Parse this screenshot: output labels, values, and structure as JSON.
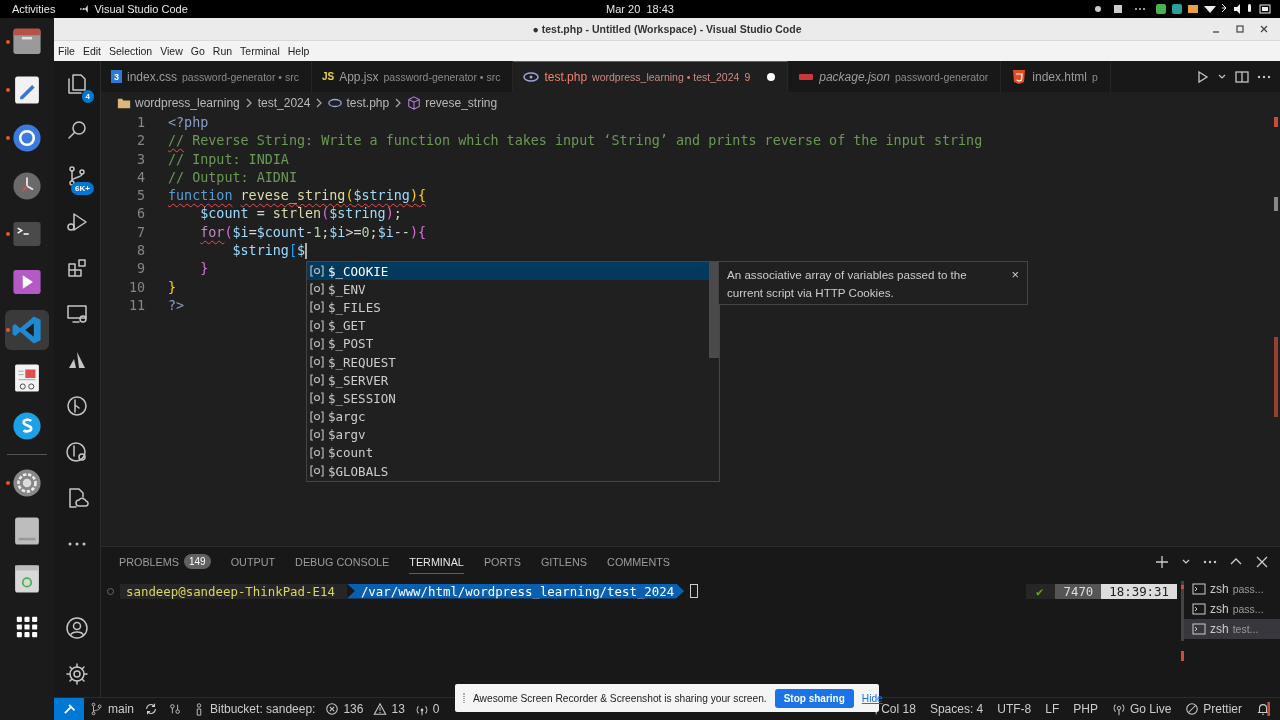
{
  "system_bar": {
    "activities": "Activities",
    "app": "Visual Studio Code",
    "clock": "Mar 20  18:43"
  },
  "dock": [
    {
      "kind": "folder",
      "running": true,
      "selected": false
    },
    {
      "kind": "text-editor",
      "running": true,
      "selected": false
    },
    {
      "kind": "browser",
      "running": true,
      "selected": false
    },
    {
      "kind": "clock",
      "running": false,
      "selected": false
    },
    {
      "kind": "terminal",
      "running": true,
      "selected": false
    },
    {
      "kind": "media-player",
      "running": false,
      "selected": false
    },
    {
      "kind": "code-editor",
      "running": true,
      "selected": true
    },
    {
      "kind": "document-viewer",
      "running": false,
      "selected": false
    },
    {
      "kind": "chat-app",
      "running": false,
      "selected": false
    },
    {
      "kind": "settings",
      "running": true,
      "selected": false
    },
    {
      "kind": "drive",
      "running": false,
      "selected": false
    },
    {
      "kind": "trash",
      "running": false,
      "selected": false
    },
    {
      "kind": "app-grid",
      "running": false,
      "selected": false
    }
  ],
  "window": {
    "title": "● test.php - Untitled (Workspace) - Visual Studio Code"
  },
  "menu": [
    "File",
    "Edit",
    "Selection",
    "View",
    "Go",
    "Run",
    "Terminal",
    "Help"
  ],
  "activity_bar": [
    {
      "kind": "explorer",
      "badge": "4"
    },
    {
      "kind": "search"
    },
    {
      "kind": "source-control",
      "badge": "6K+"
    },
    {
      "kind": "run-debug"
    },
    {
      "kind": "extensions"
    },
    {
      "kind": "remote"
    },
    {
      "kind": "atlassian"
    },
    {
      "kind": "gitlens"
    },
    {
      "kind": "gitlens-inspect"
    },
    {
      "kind": "cloud-doc"
    },
    {
      "kind": "more"
    }
  ],
  "activity_bar_bottom": [
    {
      "kind": "account"
    },
    {
      "kind": "manage"
    }
  ],
  "tabs": [
    {
      "kind": "css",
      "icon_text": "3",
      "name": "index.css",
      "path": "password-generator • src",
      "selected": false,
      "modified": false,
      "italic": false
    },
    {
      "kind": "js",
      "icon_text": "JS",
      "name": "App.jsx",
      "path": "password-generator • src",
      "selected": false,
      "modified": false,
      "italic": false
    },
    {
      "kind": "php",
      "name": "test.php",
      "path": "wordpress_learning • test_2024",
      "problems": "9",
      "selected": true,
      "modified": true,
      "italic": false
    },
    {
      "kind": "json",
      "name": "package.json",
      "path": "password-generator",
      "selected": false,
      "modified": false,
      "italic": true
    },
    {
      "kind": "html",
      "name": "index.html",
      "path": "p",
      "selected": false,
      "modified": false,
      "italic": false
    }
  ],
  "breadcrumb": [
    "wordpress_learning",
    "test_2024",
    "test.php",
    "revese_string"
  ],
  "editor": {
    "lines": [
      {
        "num": "1",
        "tokens": [
          {
            "kind": "tag",
            "t": "<?php"
          }
        ]
      },
      {
        "num": "2",
        "tokens": [
          {
            "kind": "comment",
            "t": "//",
            "err": true
          },
          {
            "kind": "comment",
            "t": " Reverse String: Write a function which takes input ‘String’ and prints reverse of the input string"
          }
        ]
      },
      {
        "num": "3",
        "tokens": [
          {
            "kind": "comment",
            "t": "// Input: INDIA"
          }
        ]
      },
      {
        "num": "4",
        "tokens": [
          {
            "kind": "comment",
            "t": "// Output: AIDNI"
          }
        ]
      },
      {
        "num": "5",
        "tokens": [
          {
            "kind": "kw",
            "t": "function",
            "err": true
          },
          {
            "kind": "fn",
            "t": " revese_string",
            "err": true
          },
          {
            "kind": "b1",
            "t": "(",
            "err": true
          },
          {
            "kind": "var",
            "t": "$string",
            "err": true
          },
          {
            "kind": "b1",
            "t": ")",
            "err": true
          },
          {
            "kind": "b1",
            "t": "{",
            "err": true
          }
        ]
      },
      {
        "num": "6",
        "tokens": [
          {
            "kind": "var",
            "t": "    $count"
          },
          {
            "kind": "plain",
            "t": " = "
          },
          {
            "kind": "fn",
            "t": "strlen"
          },
          {
            "kind": "b2",
            "t": "("
          },
          {
            "kind": "var",
            "t": "$string"
          },
          {
            "kind": "b2",
            "t": ")"
          },
          {
            "kind": "plain",
            "t": ";"
          }
        ]
      },
      {
        "num": "7",
        "tokens": [
          {
            "kind": "ctrl",
            "t": "    for",
            "err": true
          },
          {
            "kind": "b2",
            "t": "("
          },
          {
            "kind": "var",
            "t": "$i"
          },
          {
            "kind": "plain",
            "t": "="
          },
          {
            "kind": "var",
            "t": "$count"
          },
          {
            "kind": "plain",
            "t": "-"
          },
          {
            "kind": "num",
            "t": "1"
          },
          {
            "kind": "plain",
            "t": ";"
          },
          {
            "kind": "var",
            "t": "$i"
          },
          {
            "kind": "plain",
            "t": ">="
          },
          {
            "kind": "num",
            "t": "0"
          },
          {
            "kind": "plain",
            "t": ";"
          },
          {
            "kind": "var",
            "t": "$i"
          },
          {
            "kind": "plain",
            "t": "--"
          },
          {
            "kind": "b2",
            "t": ")"
          },
          {
            "kind": "b2",
            "t": "{"
          }
        ]
      },
      {
        "num": "8",
        "cursor": true,
        "tokens": [
          {
            "kind": "var",
            "t": "        $string"
          },
          {
            "kind": "b3",
            "t": "["
          },
          {
            "kind": "var",
            "t": "$"
          }
        ]
      },
      {
        "num": "9",
        "tokens": [
          {
            "kind": "b2",
            "t": "    }"
          }
        ]
      },
      {
        "num": "10",
        "tokens": [
          {
            "kind": "b1",
            "t": "}"
          }
        ]
      },
      {
        "num": "11",
        "tokens": [
          {
            "kind": "tag",
            "t": "?>"
          }
        ]
      }
    ]
  },
  "suggestions": {
    "items": [
      {
        "label": "$_COOKIE",
        "selected": true
      },
      {
        "label": "$_ENV",
        "selected": false
      },
      {
        "label": "$_FILES",
        "selected": false
      },
      {
        "label": "$_GET",
        "selected": false
      },
      {
        "label": "$_POST",
        "selected": false
      },
      {
        "label": "$_REQUEST",
        "selected": false
      },
      {
        "label": "$_SERVER",
        "selected": false
      },
      {
        "label": "$_SESSION",
        "selected": false
      },
      {
        "label": "$argc",
        "selected": false
      },
      {
        "label": "$argv",
        "selected": false
      },
      {
        "label": "$count",
        "selected": false
      },
      {
        "label": "$GLOBALS",
        "selected": false
      }
    ],
    "details": "An associative array of variables passed to the current script via HTTP Cookies.",
    "close": "×"
  },
  "panel": {
    "tabs": [
      {
        "label": "PROBLEMS",
        "badge": "149",
        "selected": false
      },
      {
        "label": "OUTPUT",
        "selected": false
      },
      {
        "label": "DEBUG CONSOLE",
        "selected": false
      },
      {
        "label": "TERMINAL",
        "selected": true
      },
      {
        "label": "PORTS",
        "selected": false
      },
      {
        "label": "GITLENS",
        "selected": false
      },
      {
        "label": "COMMENTS",
        "selected": false
      }
    ],
    "terminal": {
      "user": "sandeep@sandeep-ThinkPad-E14",
      "path": "/var/www/html/wordpress_learning/test_2024",
      "status": "✔",
      "pid": "7470",
      "time": "18:39:31"
    },
    "terminals": [
      {
        "label": "zsh",
        "detail": "pass...",
        "selected": false
      },
      {
        "label": "zsh",
        "detail": "pass...",
        "selected": false
      },
      {
        "label": "zsh",
        "detail": "test...",
        "selected": true
      }
    ]
  },
  "status_bar": {
    "left": [
      {
        "kind": "branch",
        "text": "main"
      },
      {
        "kind": "sync"
      },
      {
        "kind": "liveshare"
      },
      {
        "kind": "person",
        "text": "Bitbucket: sandeep:"
      },
      {
        "kind": "errors",
        "text": "136"
      },
      {
        "kind": "warnings",
        "text": "13"
      },
      {
        "kind": "ports",
        "text": "0"
      }
    ],
    "right": [
      {
        "kind": "plain",
        "text": ", Col 18"
      },
      {
        "kind": "plain",
        "text": "Spaces: 4"
      },
      {
        "kind": "plain",
        "text": "UTF-8"
      },
      {
        "kind": "plain",
        "text": "LF"
      },
      {
        "kind": "plain",
        "text": "PHP"
      },
      {
        "kind": "golive",
        "text": "Go Live"
      },
      {
        "kind": "prettier",
        "text": "Prettier"
      },
      {
        "kind": "bell"
      }
    ]
  },
  "share_banner": {
    "message": "Awesome Screen Recorder & Screenshot is sharing your screen.",
    "stop": "Stop sharing",
    "hide": "Hide"
  }
}
